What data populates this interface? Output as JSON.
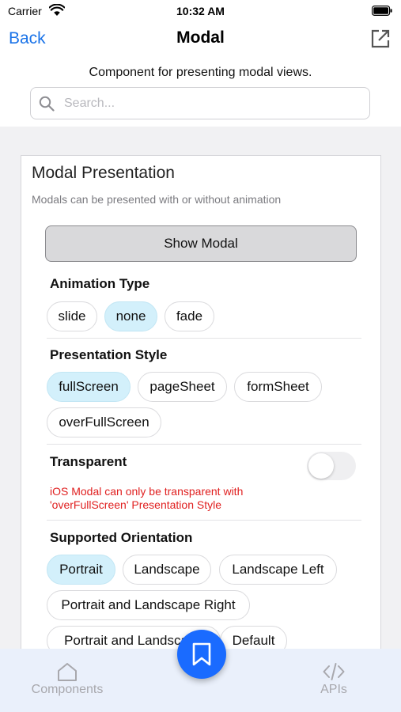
{
  "status": {
    "carrier": "Carrier",
    "time": "10:32 AM"
  },
  "nav": {
    "back": "Back",
    "title": "Modal"
  },
  "description": "Component for presenting modal views.",
  "search": {
    "placeholder": "Search..."
  },
  "card": {
    "title": "Modal Presentation",
    "subtitle": "Modals can be presented with or without animation",
    "show_button": "Show Modal",
    "animation": {
      "label": "Animation Type",
      "options": [
        "slide",
        "none",
        "fade"
      ],
      "selected": "none"
    },
    "presentation": {
      "label": "Presentation Style",
      "options": [
        "fullScreen",
        "pageSheet",
        "formSheet",
        "overFullScreen"
      ],
      "selected": "fullScreen"
    },
    "transparent": {
      "label": "Transparent",
      "value": false,
      "warning_line1": "iOS Modal can only be transparent with",
      "warning_line2": "'overFullScreen' Presentation Style"
    },
    "orientation": {
      "label": "Supported Orientation",
      "options": [
        "Portrait",
        "Landscape",
        "Landscape Left",
        "Portrait and Landscape Right",
        "Portrait and Landscape",
        "Default"
      ],
      "selected": "Portrait"
    }
  },
  "tabs": {
    "components": "Components",
    "apis": "APIs"
  },
  "colors": {
    "accent": "#1a73e8",
    "fab": "#1a6bff",
    "chip_selected": "#d3f0fb",
    "warning": "#e02020"
  }
}
